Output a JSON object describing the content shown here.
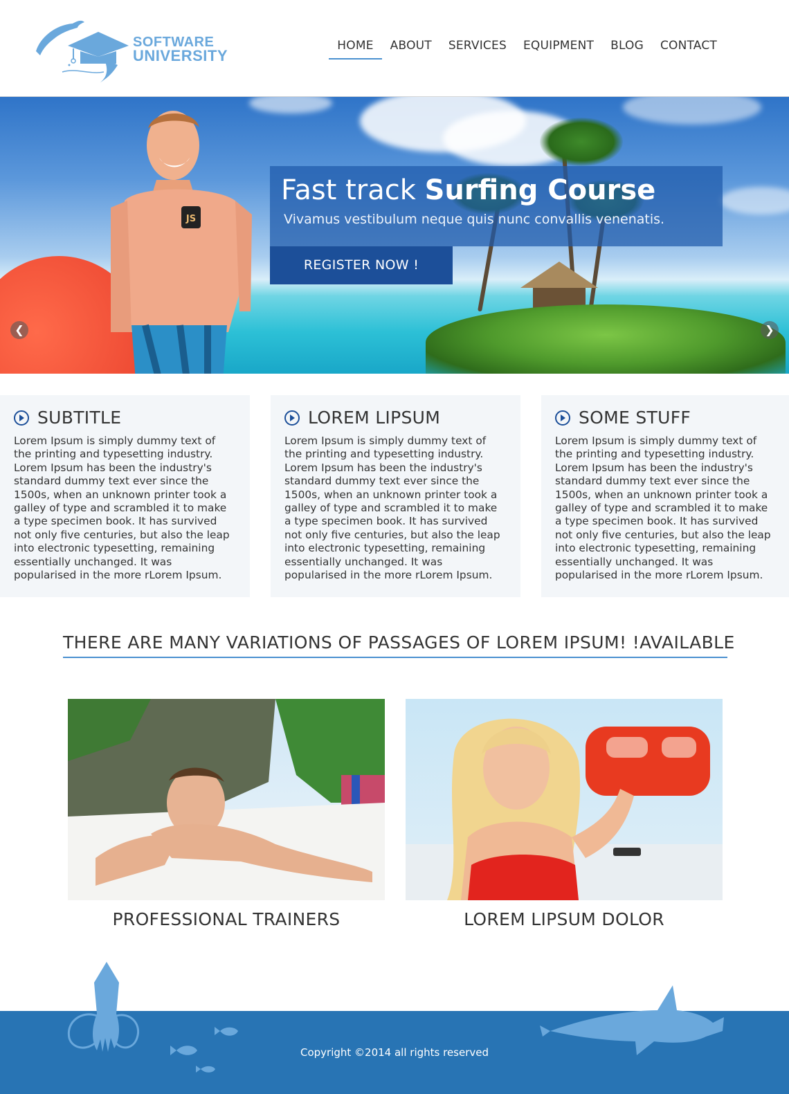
{
  "logo": {
    "line1": "SOFTWARE",
    "line2": "UNIVERSITY",
    "color": "#6aa8dc"
  },
  "nav": {
    "items": [
      {
        "label": "HOME",
        "active": true
      },
      {
        "label": "ABOUT"
      },
      {
        "label": "SERVICES"
      },
      {
        "label": "EQUIPMENT"
      },
      {
        "label": "BLOG"
      },
      {
        "label": "CONTACT"
      }
    ],
    "accent": "#4a90d0"
  },
  "hero": {
    "title_light": "Fast track ",
    "title_bold": "Surfing Course",
    "subtitle": "Vivamus vestibulum neque quis nunc convallis venenatis.",
    "cta": "REGISTER NOW !",
    "tattoo": "JS",
    "prev_icon": "chevron-left-icon",
    "next_icon": "chevron-right-icon"
  },
  "features": [
    {
      "title": "SUBTITLE",
      "text": "Lorem Ipsum is simply dummy text of the printing and typesetting industry. Lorem Ipsum has been the industry's standard dummy text ever since the 1500s, when an unknown printer took a galley of type and scrambled it to make a type specimen book. It has survived not only five centuries, but also the leap into electronic typesetting, remaining essentially unchanged. It was popularised in the more rLorem Ipsum."
    },
    {
      "title": "LOREM LIPSUM",
      "text": "Lorem Ipsum is simply dummy text of the printing and typesetting industry. Lorem Ipsum has been the industry's standard dummy text ever since the 1500s, when an unknown printer took a galley of type and scrambled it to make a type specimen book. It has survived not only five centuries, but also the leap into electronic typesetting, remaining essentially unchanged. It was popularised in the more rLorem Ipsum."
    },
    {
      "title": "SOME STUFF",
      "text": "Lorem Ipsum is simply dummy text of the printing and typesetting industry. Lorem Ipsum has been the industry's standard dummy text ever since the 1500s, when an unknown printer took a galley of type and scrambled it to make a type specimen book. It has survived not only five centuries, but also the leap into electronic typesetting, remaining essentially unchanged. It was popularised in the more rLorem Ipsum."
    }
  ],
  "section_title": "THERE ARE MANY VARIATIONS OF PASSAGES OF LOREM IPSUM! !AVAILABLE",
  "cards": [
    {
      "caption": "PROFESSIONAL TRAINERS"
    },
    {
      "caption": "LOREM LIPSUM DOLOR"
    }
  ],
  "footer": {
    "copyright": "Copyright ©2014 all rights reserved",
    "color": "#2874b4"
  }
}
